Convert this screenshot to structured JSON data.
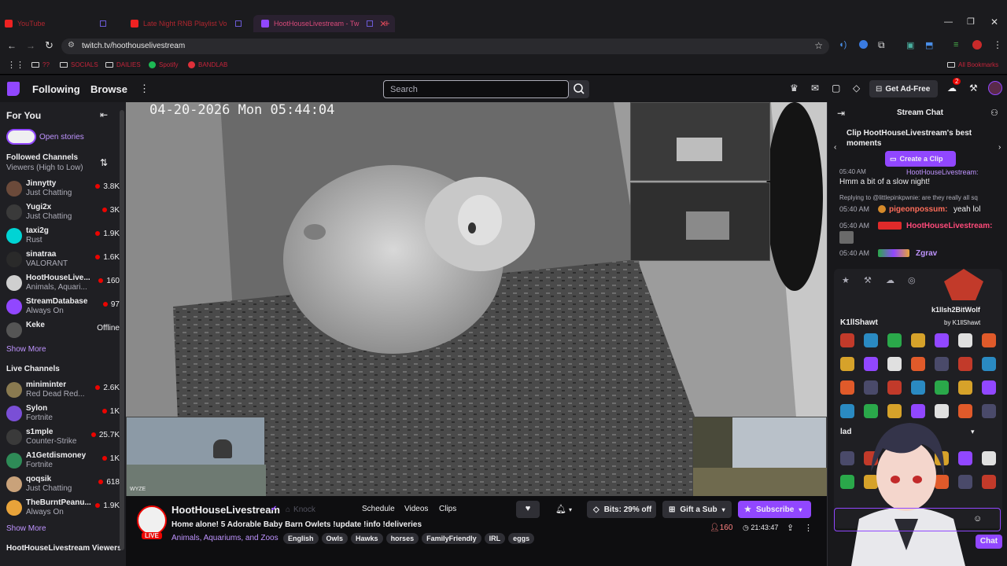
{
  "browser": {
    "tabs": [
      {
        "title": "YouTube"
      },
      {
        "title": "Late Night RNB Playlist Vo"
      },
      {
        "title": "HootHouseLivestream - Tw"
      }
    ],
    "url": "twitch.tv/hoothouselivestream",
    "bookmarks": [
      "??",
      "SOCIALS",
      "DAILIES",
      "Spotify",
      "BANDLAB"
    ],
    "all_bookmarks": "All Bookmarks"
  },
  "nav": {
    "following": "Following",
    "browse": "Browse",
    "search_placeholder": "Search",
    "get_ad_free": "Get Ad-Free",
    "notif_count": "2"
  },
  "sidebar": {
    "for_you": "For You",
    "open_stories": "Open stories",
    "followed_title": "Followed Channels",
    "followed_sort": "Viewers (High to Low)",
    "followed": [
      {
        "name": "Jinnytty",
        "game": "Just Chatting",
        "viewers": "3.8K",
        "color": "#6b4a3a"
      },
      {
        "name": "Yugi2x",
        "game": "Just Chatting",
        "viewers": "3K",
        "color": "#3a3a3a"
      },
      {
        "name": "taxi2g",
        "game": "Rust",
        "viewers": "1.9K",
        "color": "#00d4d4"
      },
      {
        "name": "sinatraa",
        "game": "VALORANT",
        "viewers": "1.6K",
        "color": "#2a2a2a"
      },
      {
        "name": "HootHouseLive...",
        "game": "Animals, Aquari...",
        "viewers": "160",
        "color": "#cfcfcf"
      },
      {
        "name": "StreamDatabase",
        "game": "Always On",
        "viewers": "97",
        "color": "#9147ff"
      },
      {
        "name": "Keke",
        "game": "",
        "viewers": "Offline",
        "color": "#555"
      }
    ],
    "show_more": "Show More",
    "live_title": "Live Channels",
    "live": [
      {
        "name": "miniminter",
        "game": "Red Dead Red...",
        "viewers": "2.6K",
        "color": "#8a7a50"
      },
      {
        "name": "Sylon",
        "game": "Fortnite",
        "viewers": "1K",
        "color": "#7a4fd6"
      },
      {
        "name": "s1mple",
        "game": "Counter-Strike",
        "viewers": "25.7K",
        "color": "#3a3a3a"
      },
      {
        "name": "A1Getdismoney",
        "game": "Fortnite",
        "viewers": "1K",
        "color": "#2e8b57"
      },
      {
        "name": "qoqsik",
        "game": "Just Chatting",
        "viewers": "618",
        "color": "#c9a27a"
      },
      {
        "name": "TheBurntPeanu...",
        "game": "Always On",
        "viewers": "1.9K",
        "color": "#e8a33a"
      }
    ],
    "show_more_2": "Show More",
    "viewers_section": "HootHouseLivestream Viewers"
  },
  "video": {
    "timestamp": "04-20-2026 Mon 05:44:04",
    "pip_label": "WYZE"
  },
  "stream": {
    "channel": "HootHouseLivestream",
    "knock": "Knock",
    "tabs": [
      "Schedule",
      "Videos",
      "Clips"
    ],
    "title": "Home alone! 5 Adorable Baby Barn Owlets !update !info !deliveries",
    "category": "Animals, Aquariums, and Zoos",
    "tags": [
      "English",
      "Owls",
      "Hawks",
      "horses",
      "FamilyFriendly",
      "IRL",
      "eggs"
    ],
    "live_badge": "LIVE",
    "bits": "Bits: 29% off",
    "gift": "Gift a Sub",
    "subscribe": "Subscribe",
    "viewers": "160",
    "uptime": "21:43:47"
  },
  "chat": {
    "header": "Stream Chat",
    "clip_promo": "Clip HootHouseLivestream's best moments",
    "create_clip": "Create a Clip",
    "messages": [
      {
        "time": "05:40 AM",
        "user": "HootHouseLivestream:",
        "text": "Hmm a bit of a slow night!"
      },
      {
        "reply": "Replying to @littlepinkpwnie: are they really all sq"
      },
      {
        "time": "05:40 AM",
        "user": "pigeonpossum:",
        "text": "yeah lol"
      },
      {
        "time": "05:40 AM",
        "user": "HootHouseLivestream:",
        "text": ""
      },
      {
        "time": "05:40 AM",
        "user": "Zgrav",
        "text": ""
      }
    ],
    "emote_author": "k1llsh2BitWolf",
    "emote_by": "by K1llShawt",
    "emote_set_1": "K1llShawt",
    "emote_set_2": "lad",
    "chat_button": "Chat"
  }
}
